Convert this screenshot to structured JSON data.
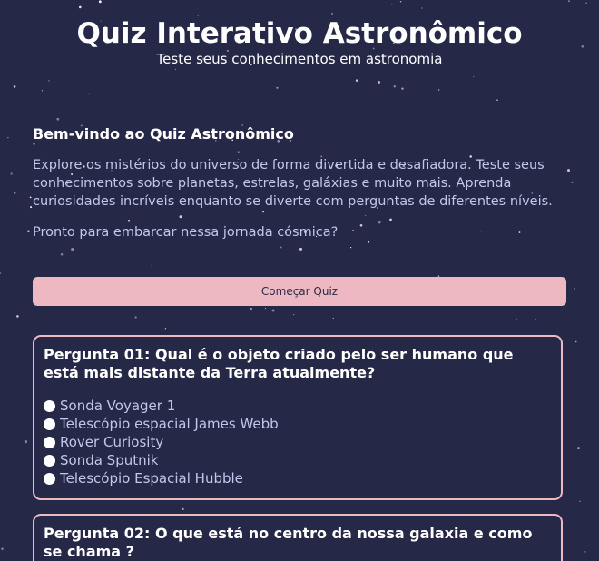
{
  "header": {
    "title": "Quiz Interativo Astronômico",
    "subtitle": "Teste seus conhecimentos em astronomia"
  },
  "intro": {
    "heading": "Bem-vindo ao Quiz Astronômico",
    "description": "Explore os mistérios do universo de forma divertida e desafiadora. Teste seus conhecimentos sobre planetas, estrelas, galáxias e muito mais. Aprenda curiosidades incríveis enquanto se diverte com perguntas de diferentes níveis.",
    "prompt": "Pronto para embarcar nessa jornada cósmica?",
    "start_button_label": "Começar Quiz"
  },
  "questions": [
    {
      "text": "Pergunta 01: Qual é o objeto criado pelo ser humano que está mais distante da Terra atualmente?",
      "options": [
        "Sonda Voyager 1",
        "Telescópio espacial James Webb",
        "Rover Curiosity",
        "Sonda Sputnik",
        "Telescópio Espacial Hubble"
      ]
    },
    {
      "text": "Pergunta 02: O que está no centro da nossa galaxia e como se chama ?"
    }
  ],
  "colors": {
    "background": "#262847",
    "accent": "#eeb8c3",
    "body_text": "#c3c6ec"
  }
}
